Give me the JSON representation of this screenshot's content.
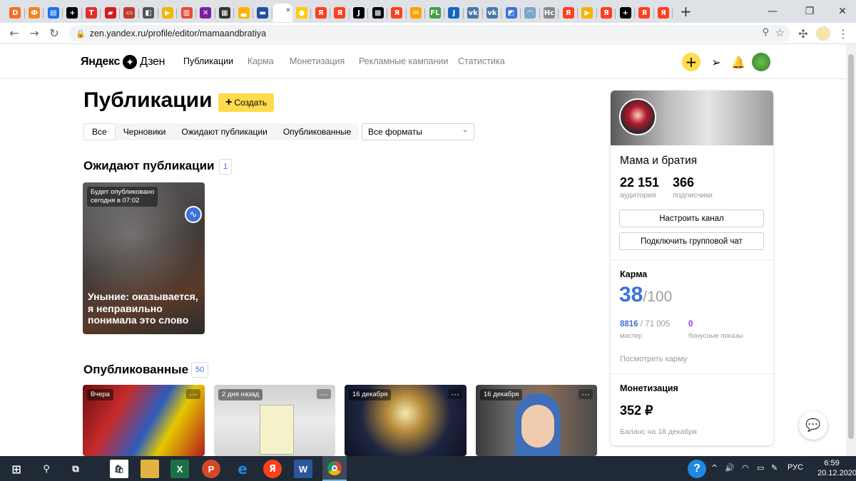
{
  "browser": {
    "url": "zen.yandex.ru/profile/editor/mamaandbratiya",
    "tab_favicons": [
      {
        "color": "#f37021",
        "glyph": "D"
      },
      {
        "color": "#f58220",
        "glyph": "Ф"
      },
      {
        "color": "#1a73e8",
        "glyph": "▤"
      },
      {
        "color": "#000000",
        "glyph": "+"
      },
      {
        "color": "#e12d2d",
        "glyph": "T"
      },
      {
        "color": "#d41c1c",
        "glyph": "▰"
      },
      {
        "color": "#c0392b",
        "glyph": "▭"
      },
      {
        "color": "#555555",
        "glyph": "◧"
      },
      {
        "color": "#f2b500",
        "glyph": "▶"
      },
      {
        "color": "#e74c3c",
        "glyph": "▥"
      },
      {
        "color": "#7b1fa2",
        "glyph": "✕"
      },
      {
        "color": "#333333",
        "glyph": "▦"
      },
      {
        "color": "#ffb300",
        "glyph": "▃"
      },
      {
        "color": "#1e4fa3",
        "glyph": "▬"
      },
      {
        "color": "#fc3f1d",
        "glyph": "Я"
      },
      {
        "color": "#ffcc00",
        "glyph": "●"
      },
      {
        "color": "#fc3f1d",
        "glyph": "Я"
      },
      {
        "color": "#fc3f1d",
        "glyph": "Я"
      },
      {
        "color": "#000000",
        "glyph": "J"
      },
      {
        "color": "#000000",
        "glyph": "▩"
      },
      {
        "color": "#fc3f1d",
        "glyph": "Я"
      },
      {
        "color": "#ffa000",
        "glyph": "✉"
      },
      {
        "color": "#43a047",
        "glyph": "FL"
      },
      {
        "color": "#1565c0",
        "glyph": "J"
      },
      {
        "color": "#4a76a8",
        "glyph": "vk"
      },
      {
        "color": "#4a76a8",
        "glyph": "vk"
      },
      {
        "color": "#3c72d9",
        "glyph": "◩"
      },
      {
        "color": "#7aa7c7",
        "glyph": "◠"
      },
      {
        "color": "#888888",
        "glyph": "Hc"
      },
      {
        "color": "#fc3f1d",
        "glyph": "Я"
      },
      {
        "color": "#f2b500",
        "glyph": "▶"
      },
      {
        "color": "#fc3f1d",
        "glyph": "Я"
      },
      {
        "color": "#000000",
        "glyph": "+"
      },
      {
        "color": "#fc3f1d",
        "glyph": "Я"
      },
      {
        "color": "#fc3f1d",
        "glyph": "Я"
      }
    ]
  },
  "header": {
    "logo_text_1": "Яндекс",
    "logo_text_2": "Дзен",
    "nav": [
      "Публикации",
      "Карма",
      "Монетизация",
      "Рекламные кампании",
      "Статистика"
    ]
  },
  "main": {
    "title": "Публикации",
    "create_label": "Создать",
    "filters": [
      "Все",
      "Черновики",
      "Ожидают публикации",
      "Опубликованные"
    ],
    "format_select": "Все форматы",
    "pending": {
      "heading": "Ожидают публикации",
      "count": "1",
      "card": {
        "label_line1": "Будет опубликовано",
        "label_line2": "сегодня в 07:02",
        "title": "Уныние: оказывается, я неправильно понимала это слово"
      }
    },
    "published": {
      "heading": "Опубликованные",
      "count": "50",
      "cards": [
        {
          "label": "Вчера",
          "dots": "···"
        },
        {
          "label": "2 дня назад",
          "dots": "···"
        },
        {
          "label": "16 декабря",
          "dots": "···"
        },
        {
          "label": "16 декабря",
          "dots": "···"
        }
      ]
    }
  },
  "aside": {
    "channel_name": "Мама и братия",
    "audience_value": "22 151",
    "audience_label": "аудитория",
    "subs_value": "366",
    "subs_label": "подписчики",
    "btn_configure": "Настроить канал",
    "btn_chat": "Подключить групповой чат",
    "karma_heading": "Карма",
    "karma_value": "38",
    "karma_max": "/100",
    "karma_stat1_value": "8816",
    "karma_stat1_total": " / 71 005",
    "karma_stat1_label": "мастер",
    "karma_stat2_value": "0",
    "karma_stat2_label": "бонусные показы",
    "karma_link": "Посмотреть карму",
    "monet_heading": "Монетизация",
    "monet_value": "352 ₽",
    "monet_note": "Баланс на 18 декабря"
  },
  "taskbar": {
    "lang": "РУС",
    "time": "6:59",
    "date": "20.12.2020"
  },
  "colors": {
    "accent_yellow": "#ffdb4d",
    "karma_blue": "#3c72d9",
    "bonus_purple": "#8b3fd9"
  }
}
